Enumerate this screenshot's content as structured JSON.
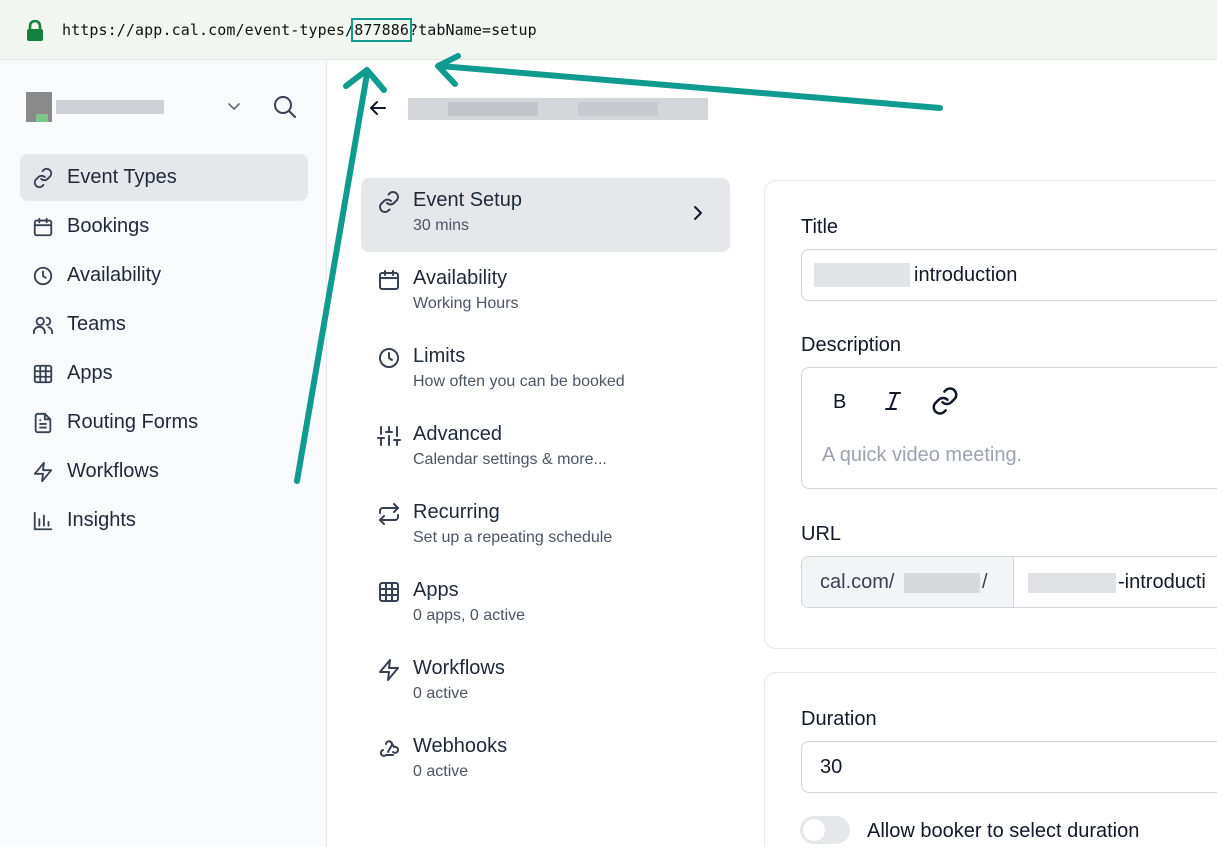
{
  "browser": {
    "url_prefix": "https://app.cal.com/event-types/",
    "url_id": "877886",
    "url_suffix": "?tabName=setup"
  },
  "sidebar": {
    "items": [
      {
        "label": "Event Types",
        "icon": "link-icon",
        "active": true
      },
      {
        "label": "Bookings",
        "icon": "calendar-icon"
      },
      {
        "label": "Availability",
        "icon": "clock-icon"
      },
      {
        "label": "Teams",
        "icon": "users-icon"
      },
      {
        "label": "Apps",
        "icon": "grid-icon"
      },
      {
        "label": "Routing Forms",
        "icon": "file-text-icon"
      },
      {
        "label": "Workflows",
        "icon": "zap-icon"
      },
      {
        "label": "Insights",
        "icon": "bar-chart-icon"
      }
    ]
  },
  "steps": [
    {
      "title": "Event Setup",
      "desc": "30 mins",
      "icon": "link-icon",
      "active": true
    },
    {
      "title": "Availability",
      "desc": "Working Hours",
      "icon": "calendar-icon"
    },
    {
      "title": "Limits",
      "desc": "How often you can be booked",
      "icon": "clock-icon"
    },
    {
      "title": "Advanced",
      "desc": "Calendar settings & more...",
      "icon": "sliders-icon"
    },
    {
      "title": "Recurring",
      "desc": "Set up a repeating schedule",
      "icon": "repeat-icon"
    },
    {
      "title": "Apps",
      "desc": "0 apps, 0 active",
      "icon": "grid-icon"
    },
    {
      "title": "Workflows",
      "desc": "0 active",
      "icon": "zap-icon"
    },
    {
      "title": "Webhooks",
      "desc": "0 active",
      "icon": "webhook-icon"
    }
  ],
  "form": {
    "title_label": "Title",
    "title_value_suffix": "introduction",
    "description_label": "Description",
    "description_placeholder": "A quick video meeting.",
    "url_label": "URL",
    "url_prefix_start": "cal.com/",
    "url_prefix_end": "/",
    "url_slug_suffix": "-introducti",
    "duration_label": "Duration",
    "duration_value": "30",
    "allow_duration_label": "Allow booker to select duration"
  },
  "colors": {
    "annotation": "#0f9b8e",
    "lock": "#15803d"
  }
}
